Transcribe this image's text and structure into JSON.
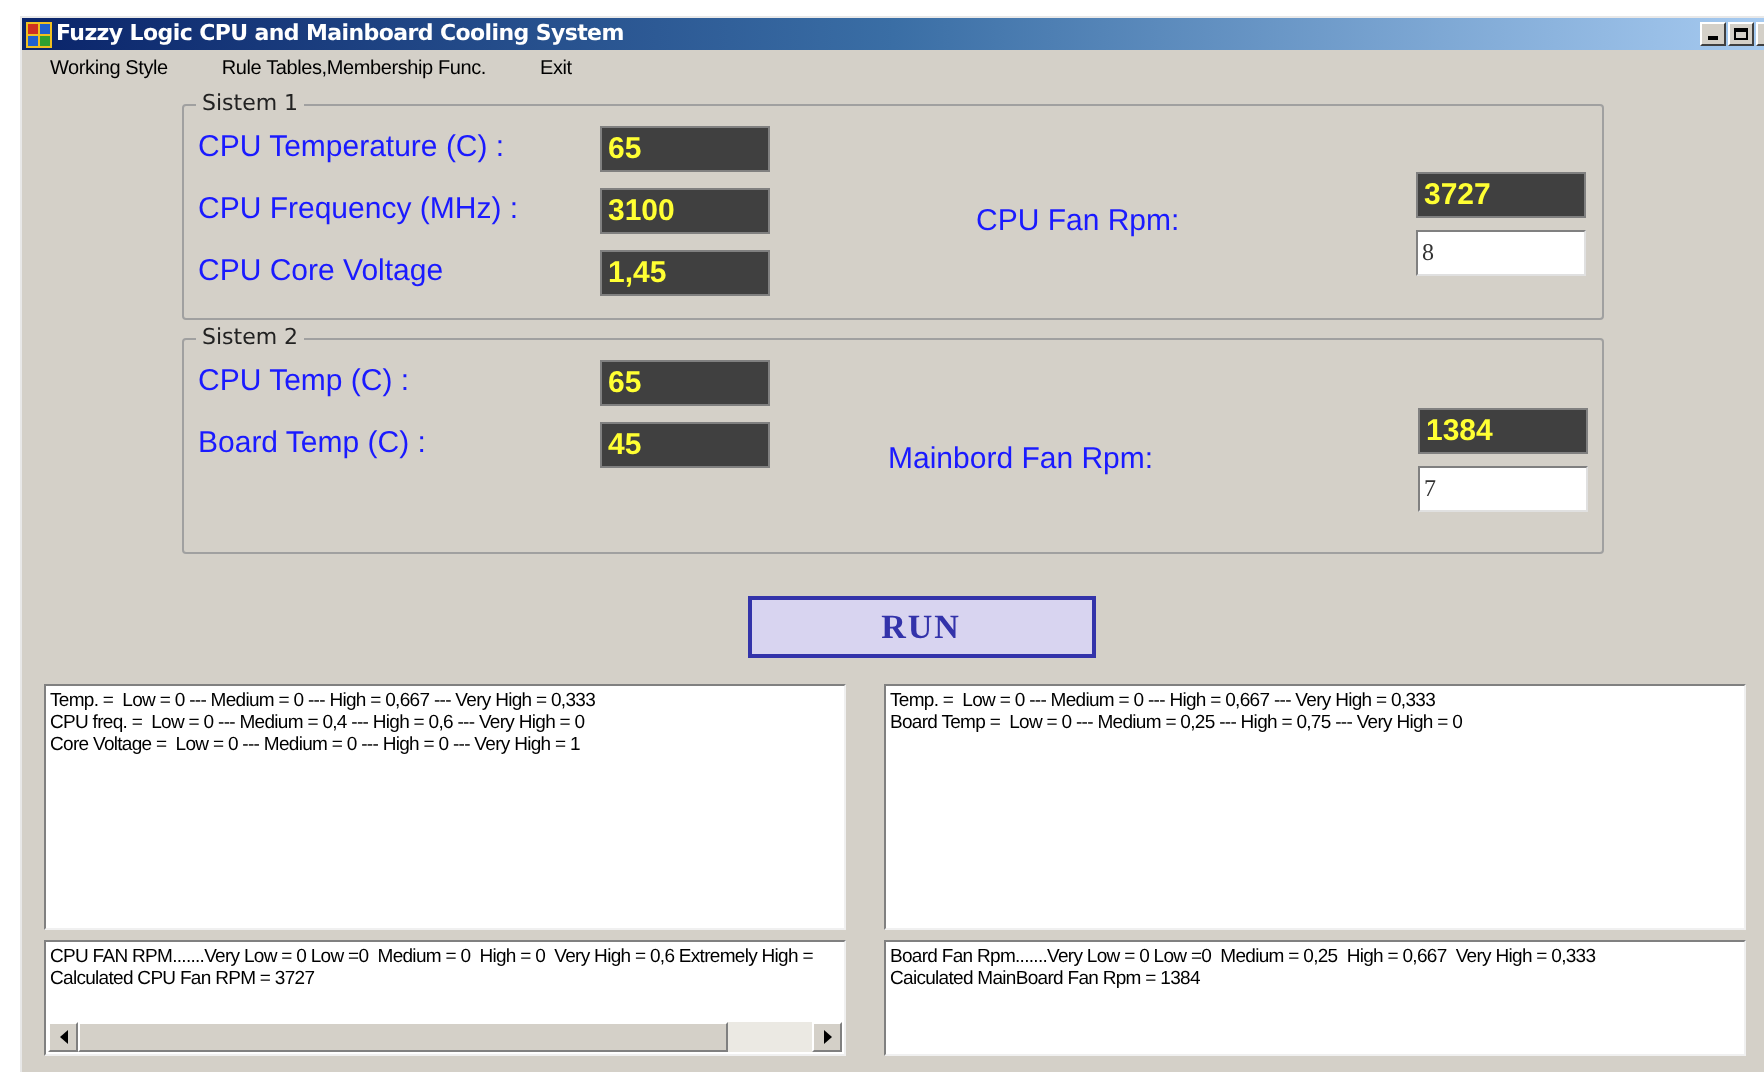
{
  "window": {
    "title": "Fuzzy Logic CPU and Mainboard Cooling System"
  },
  "menu": [
    "Working Style",
    "Rule Tables,Membership Func.",
    "Exit"
  ],
  "groups": [
    {
      "title": "Sistem 1",
      "inputs": [
        {
          "label": "CPU Temperature (C) :",
          "value": "65"
        },
        {
          "label": "CPU Frequency (MHz) :",
          "value": "3100"
        },
        {
          "label": "CPU Core Voltage",
          "value": "1,45"
        }
      ],
      "output": {
        "label": "CPU Fan Rpm:",
        "value": "3727",
        "entry": "8"
      }
    },
    {
      "title": "Sistem 2",
      "inputs": [
        {
          "label": "CPU Temp (C) :",
          "value": "65"
        },
        {
          "label": "Board Temp (C) :",
          "value": "45"
        }
      ],
      "output": {
        "label": "Mainbord Fan Rpm:",
        "value": "1384",
        "entry": "7"
      }
    }
  ],
  "run_button": "RUN",
  "membership_boxes": [
    {
      "kind": "plain",
      "lines": [
        "Temp. =  Low = 0 --- Medium = 0 --- High = 0,667 --- Very High = 0,333",
        "CPU freq. =  Low = 0 --- Medium = 0,4 --- High = 0,6 --- Very High = 0",
        "Core Voltage =  Low = 0 --- Medium = 0 --- High = 0 --- Very High = 1"
      ]
    },
    {
      "kind": "plain",
      "lines": [
        "Temp. =  Low = 0 --- Medium = 0 --- High = 0,667 --- Very High = 0,333",
        "Board Temp =  Low = 0 --- Medium = 0,25 --- High = 0,75 --- Very High = 0"
      ]
    }
  ],
  "result_boxes": [
    {
      "kind": "scrolling",
      "lines": [
        "CPU FAN RPM.......Very Low = 0 Low =0  Medium = 0  High = 0  Very High = 0,6 Extremely High =",
        "Calculated CPU Fan RPM = 3727"
      ]
    },
    {
      "kind": "plain",
      "lines": [
        "Board Fan Rpm.......Very Low = 0 Low =0  Medium = 0,25  High = 0,667  Very High = 0,333",
        "Caiculated MainBoard Fan Rpm = 1384"
      ]
    }
  ]
}
